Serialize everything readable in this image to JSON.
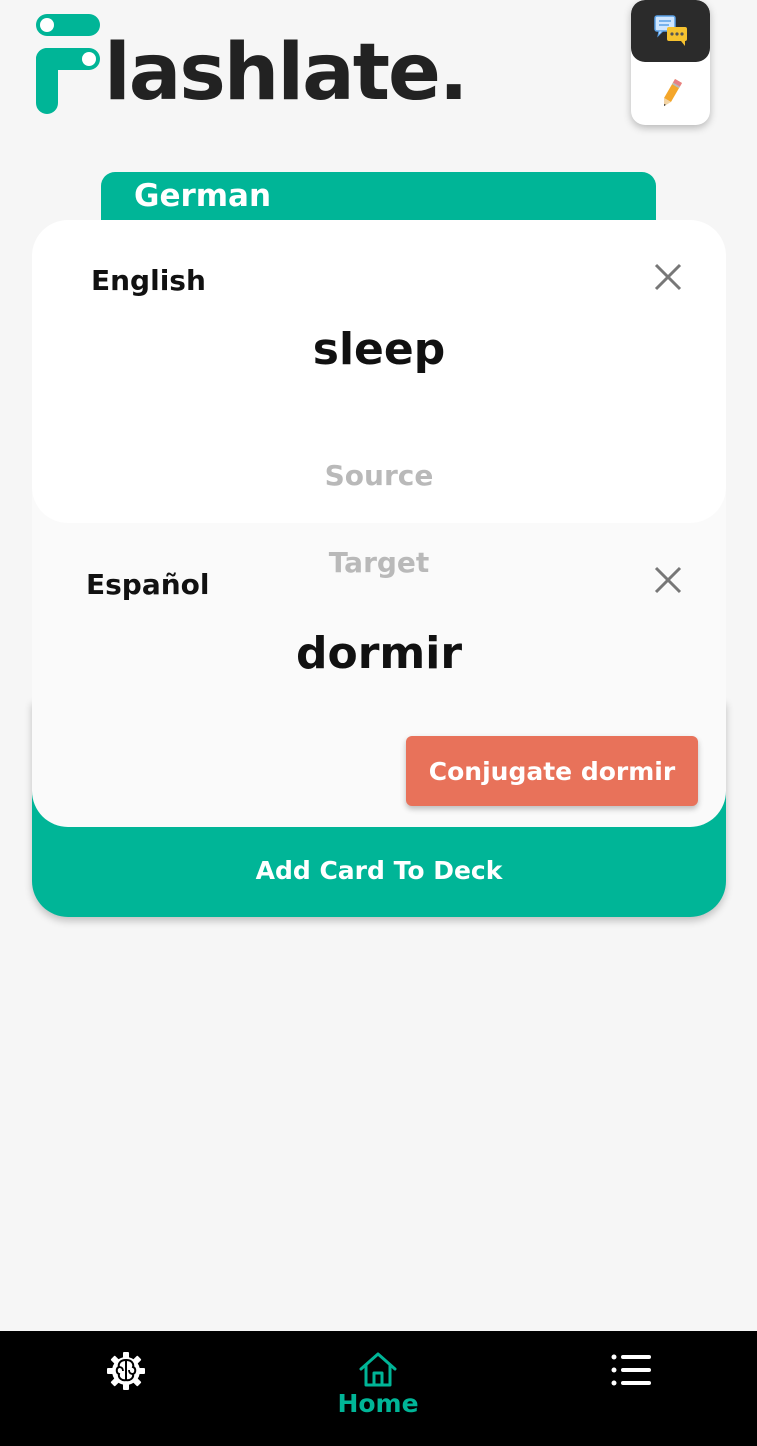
{
  "app": {
    "logo_text": "lashlate."
  },
  "colors": {
    "brand": "#00b597",
    "accent_button": "#e8725a",
    "text": "#111111",
    "hint": "#b9b9b9"
  },
  "mode_toggle": {
    "chat_icon": "chat-bubbles-icon",
    "edit_icon": "pencil-icon"
  },
  "deck": {
    "label": "German"
  },
  "source": {
    "language_label": "English",
    "word": "sleep",
    "hint": "Source",
    "clear_icon": "close-icon"
  },
  "target": {
    "language_label": "Español",
    "word": "dormir",
    "hint": "Target",
    "clear_icon": "close-icon",
    "conjugate_label": "Conjugate dormir"
  },
  "actions": {
    "add_card_label": "Add Card To Deck"
  },
  "bottom_nav": {
    "items": [
      {
        "icon": "brain-gear-icon",
        "label": ""
      },
      {
        "icon": "home-icon",
        "label": "Home",
        "active": true
      },
      {
        "icon": "list-icon",
        "label": ""
      }
    ]
  }
}
